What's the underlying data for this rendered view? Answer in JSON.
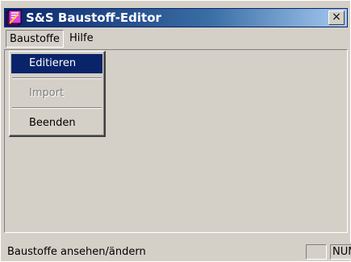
{
  "window": {
    "title": "S&S Baustoff-Editor",
    "close_glyph": "×",
    "icon": "app-book-icon"
  },
  "menubar": {
    "items": [
      {
        "label": "Baustoffe"
      },
      {
        "label": "Hilfe"
      }
    ]
  },
  "dropdown": {
    "items": [
      {
        "label": "Editieren",
        "state": "selected"
      },
      {
        "label": "Import",
        "state": "disabled"
      },
      {
        "label": "Beenden",
        "state": "normal"
      }
    ]
  },
  "statusbar": {
    "text": "Baustoffe ansehen/ändern",
    "pane1": "",
    "pane2": "NUM"
  },
  "colors": {
    "titlebar_start": "#0a246a",
    "titlebar_end": "#a6caf0",
    "face": "#d4d0c8",
    "selection": "#0a246a"
  }
}
